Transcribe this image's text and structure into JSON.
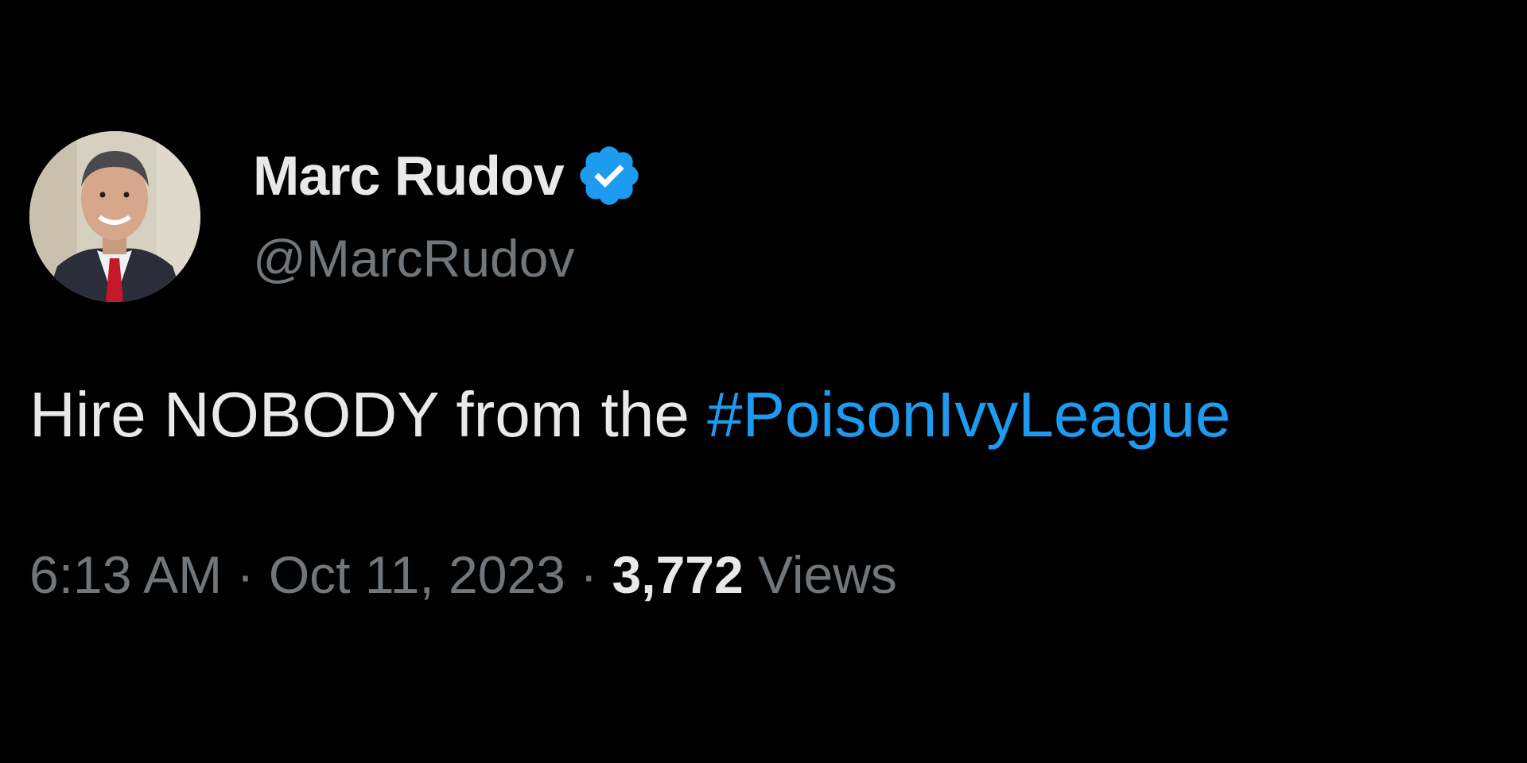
{
  "author": {
    "display_name": "Marc Rudov",
    "handle": "@MarcRudov",
    "verified": true,
    "verified_icon": "verified-badge-icon",
    "avatar": "profile-photo"
  },
  "tweet": {
    "text_prefix": "Hire NOBODY from the ",
    "hashtag": "#PoisonIvyLeague"
  },
  "meta": {
    "time": "6:13 AM",
    "separator": "·",
    "date": "Oct 11, 2023",
    "views_count": "3,772",
    "views_label": "Views"
  },
  "colors": {
    "background": "#000000",
    "primary_text": "#e7e9ea",
    "secondary_text": "#71767b",
    "accent": "#1d9bf0"
  }
}
